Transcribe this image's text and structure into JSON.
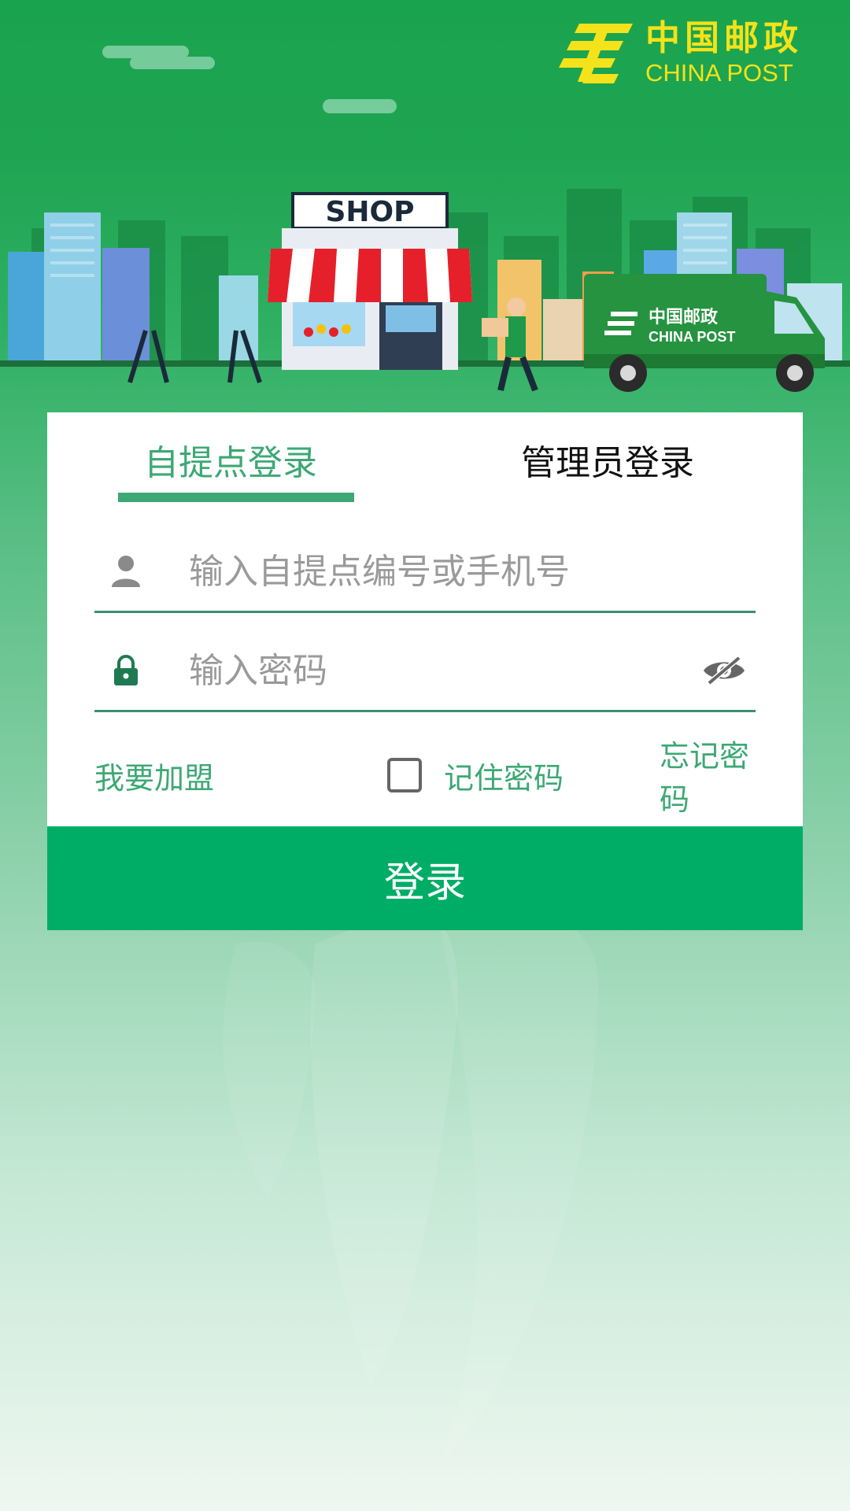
{
  "brand": {
    "name_cn": "中国邮政",
    "name_en": "CHINA POST",
    "shop_sign": "SHOP",
    "truck_cn": "中国邮政",
    "truck_en": "CHINA POST",
    "brand_yellow": "#f4e21a",
    "brand_green": "#00ad67"
  },
  "tabs": [
    {
      "label": "自提点登录",
      "active": true
    },
    {
      "label": "管理员登录",
      "active": false
    }
  ],
  "form": {
    "username": {
      "value": "",
      "placeholder": "输入自提点编号或手机号",
      "icon": "person-icon"
    },
    "password": {
      "value": "",
      "placeholder": "输入密码",
      "icon": "lock-icon",
      "toggle_icon": "eye-off-icon"
    },
    "join_label": "我要加盟",
    "remember_label": "记住密码",
    "remember_checked": false,
    "forgot_label": "忘记密码",
    "submit_label": "登录"
  }
}
